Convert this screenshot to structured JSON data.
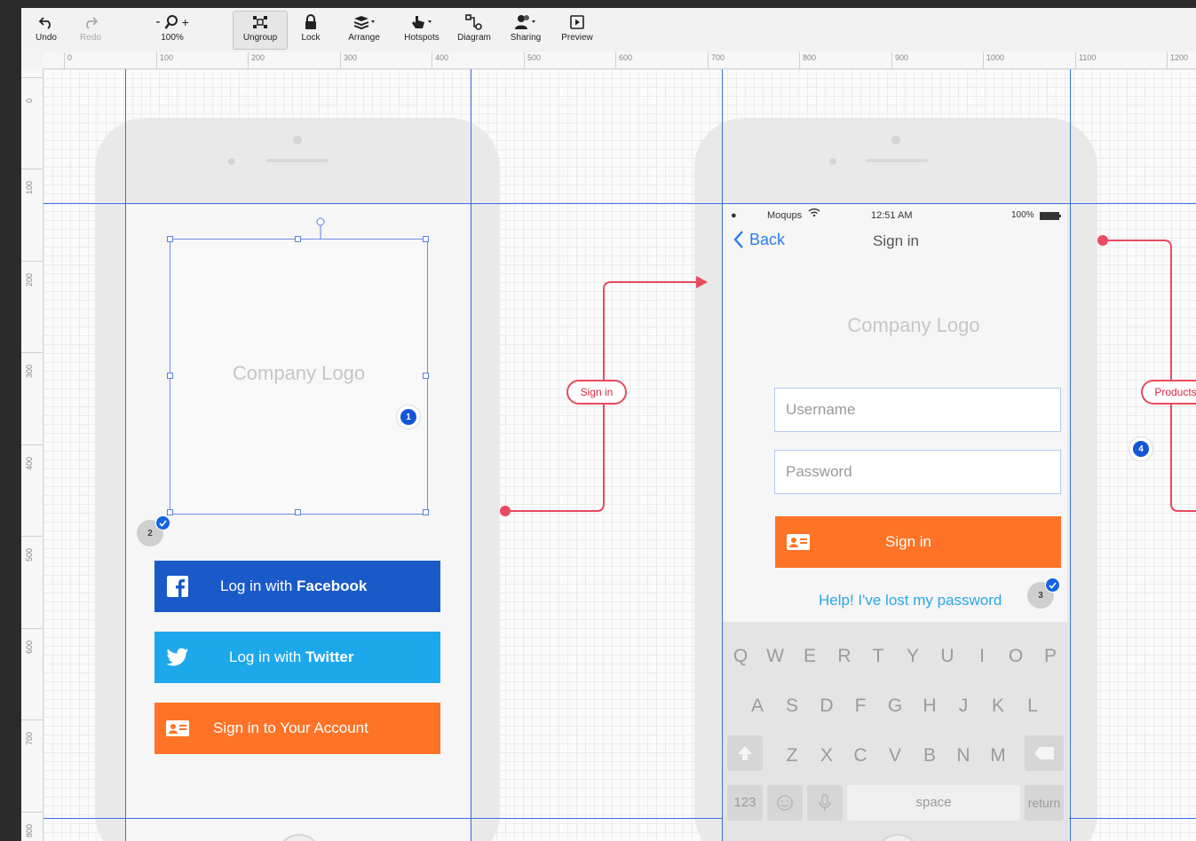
{
  "toolbar": {
    "undo": "Undo",
    "redo": "Redo",
    "zoom": "100%",
    "zoom_minus": "-",
    "zoom_plus": "+",
    "ungroup": "Ungroup",
    "lock": "Lock",
    "arrange": "Arrange",
    "hotspots": "Hotspots",
    "diagram": "Diagram",
    "sharing": "Sharing",
    "preview": "Preview"
  },
  "ruler_top": [
    "0",
    "100",
    "200",
    "300",
    "400",
    "500",
    "600",
    "700",
    "800",
    "900",
    "1000",
    "1100",
    "1200"
  ],
  "ruler_left": [
    "0",
    "100",
    "200",
    "300",
    "400",
    "500",
    "600",
    "700",
    "800"
  ],
  "screen1": {
    "logo_text": "Company Logo",
    "badge1": "1",
    "badge2": "2",
    "facebook_label": "Log in with ",
    "facebook_brand": "Facebook",
    "twitter_label": "Log in with ",
    "twitter_brand": "Twitter",
    "signin_account": "Sign in to Your Account"
  },
  "connector_signin": "Sign in",
  "connector_products": "Products",
  "badge4": "4",
  "screen2": {
    "carrier": "Moqups",
    "time": "12:51 AM",
    "battery": "100%",
    "back": "Back",
    "title": "Sign in",
    "logo_text": "Company Logo",
    "username_placeholder": "Username",
    "password_placeholder": "Password",
    "signin_button": "Sign in",
    "help_link": "Help! I've lost my password",
    "badge3": "3",
    "keyboard": {
      "row1": [
        "Q",
        "W",
        "E",
        "R",
        "T",
        "Y",
        "U",
        "I",
        "O",
        "P"
      ],
      "row2": [
        "A",
        "S",
        "D",
        "F",
        "G",
        "H",
        "J",
        "K",
        "L"
      ],
      "row3": [
        "Z",
        "X",
        "C",
        "V",
        "B",
        "N",
        "M"
      ],
      "numbers": "123",
      "space": "space",
      "return": "return"
    }
  },
  "colors": {
    "facebook": "#1a5ac8",
    "twitter": "#1ea8ec",
    "orange": "#fe7326",
    "guide": "#3b6fe0",
    "connector": "#e94a5e",
    "link": "#2aa7e6"
  }
}
